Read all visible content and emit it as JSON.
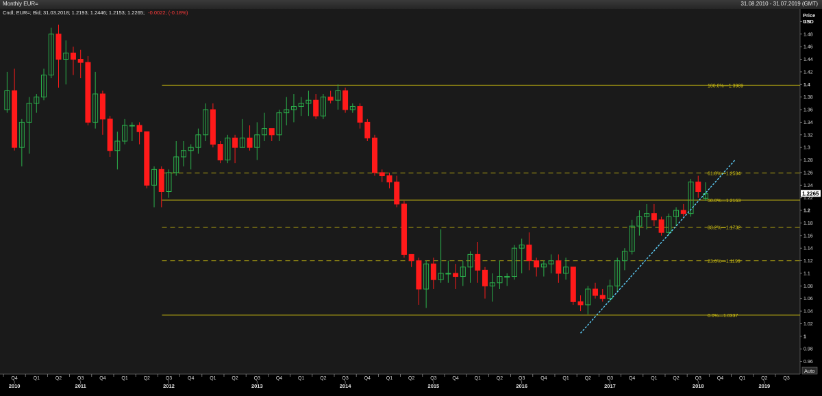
{
  "window": {
    "title": "Monthly EUR=",
    "date_range": "31.08.2010 - 31.07.2019 (GMT)"
  },
  "legend": {
    "prefix": "Cndl; EUR=; Bid; 31.03.2018; 1.2193; 1.2446; 1.2153; 1.2265;",
    "change": "-0.0022; (-0.18%)"
  },
  "axis_controls": {
    "price_label": "Price",
    "currency_label": "USD",
    "auto_button": "Auto"
  },
  "colors": {
    "background": "#1a1a1a",
    "up": "#2bb24c",
    "down": "#ff1a1a",
    "fib": "#d4c410",
    "trend": "#5fd3ff",
    "change": "#ff3b3b"
  },
  "chart_data": {
    "type": "candlestick",
    "ylim": [
      0.94,
      1.52
    ],
    "yticks": [
      "0.96",
      "0.98",
      "1",
      "1.02",
      "1.04",
      "1.06",
      "1.08",
      "1.1",
      "1.12",
      "1.14",
      "1.16",
      "1.18",
      "1.2",
      "1.22",
      "1.24",
      "1.26",
      "1.28",
      "1.3",
      "1.32",
      "1.34",
      "1.36",
      "1.38",
      "1.4",
      "1.42",
      "1.44",
      "1.46",
      "1.48",
      "1.5"
    ],
    "last_price": "1.2265",
    "start_month": "2010-10",
    "end_month": "2019-09",
    "quarters": [
      {
        "label": "Q4",
        "year": "2010"
      },
      {
        "label": "Q1",
        "year": ""
      },
      {
        "label": "Q2",
        "year": ""
      },
      {
        "label": "Q3",
        "year": "2011"
      },
      {
        "label": "Q4",
        "year": ""
      },
      {
        "label": "Q1",
        "year": ""
      },
      {
        "label": "Q2",
        "year": ""
      },
      {
        "label": "Q3",
        "year": "2012"
      },
      {
        "label": "Q4",
        "year": ""
      },
      {
        "label": "Q1",
        "year": ""
      },
      {
        "label": "Q2",
        "year": ""
      },
      {
        "label": "Q3",
        "year": "2013"
      },
      {
        "label": "Q4",
        "year": ""
      },
      {
        "label": "Q1",
        "year": ""
      },
      {
        "label": "Q2",
        "year": ""
      },
      {
        "label": "Q3",
        "year": "2014"
      },
      {
        "label": "Q4",
        "year": ""
      },
      {
        "label": "Q1",
        "year": ""
      },
      {
        "label": "Q2",
        "year": ""
      },
      {
        "label": "Q3",
        "year": "2015"
      },
      {
        "label": "Q4",
        "year": ""
      },
      {
        "label": "Q1",
        "year": ""
      },
      {
        "label": "Q2",
        "year": ""
      },
      {
        "label": "Q3",
        "year": "2016"
      },
      {
        "label": "Q4",
        "year": ""
      },
      {
        "label": "Q1",
        "year": ""
      },
      {
        "label": "Q2",
        "year": ""
      },
      {
        "label": "Q3",
        "year": "2017"
      },
      {
        "label": "Q4",
        "year": ""
      },
      {
        "label": "Q1",
        "year": ""
      },
      {
        "label": "Q2",
        "year": ""
      },
      {
        "label": "Q3",
        "year": "2018"
      },
      {
        "label": "Q4",
        "year": ""
      },
      {
        "label": "Q1",
        "year": ""
      },
      {
        "label": "Q2",
        "year": "2019"
      },
      {
        "label": "Q3",
        "year": ""
      }
    ],
    "candles": [
      {
        "date": "2010-10",
        "o": 1.36,
        "h": 1.42,
        "l": 1.355,
        "c": 1.39
      },
      {
        "date": "2010-11",
        "o": 1.39,
        "h": 1.425,
        "l": 1.295,
        "c": 1.3
      },
      {
        "date": "2010-12",
        "o": 1.3,
        "h": 1.345,
        "l": 1.27,
        "c": 1.34
      },
      {
        "date": "2011-01",
        "o": 1.34,
        "h": 1.38,
        "l": 1.29,
        "c": 1.37
      },
      {
        "date": "2011-02",
        "o": 1.37,
        "h": 1.385,
        "l": 1.355,
        "c": 1.38
      },
      {
        "date": "2011-03",
        "o": 1.38,
        "h": 1.425,
        "l": 1.375,
        "c": 1.415
      },
      {
        "date": "2011-04",
        "o": 1.415,
        "h": 1.49,
        "l": 1.41,
        "c": 1.48
      },
      {
        "date": "2011-05",
        "o": 1.48,
        "h": 1.495,
        "l": 1.395,
        "c": 1.44
      },
      {
        "date": "2011-06",
        "o": 1.44,
        "h": 1.47,
        "l": 1.4,
        "c": 1.45
      },
      {
        "date": "2011-07",
        "o": 1.45,
        "h": 1.46,
        "l": 1.415,
        "c": 1.44
      },
      {
        "date": "2011-08",
        "o": 1.44,
        "h": 1.455,
        "l": 1.41,
        "c": 1.435
      },
      {
        "date": "2011-09",
        "o": 1.435,
        "h": 1.445,
        "l": 1.335,
        "c": 1.34
      },
      {
        "date": "2011-10",
        "o": 1.34,
        "h": 1.42,
        "l": 1.33,
        "c": 1.385
      },
      {
        "date": "2011-11",
        "o": 1.385,
        "h": 1.39,
        "l": 1.32,
        "c": 1.345
      },
      {
        "date": "2011-12",
        "o": 1.345,
        "h": 1.35,
        "l": 1.285,
        "c": 1.295
      },
      {
        "date": "2012-01",
        "o": 1.295,
        "h": 1.325,
        "l": 1.265,
        "c": 1.31
      },
      {
        "date": "2012-02",
        "o": 1.31,
        "h": 1.345,
        "l": 1.305,
        "c": 1.335
      },
      {
        "date": "2012-03",
        "o": 1.335,
        "h": 1.34,
        "l": 1.31,
        "c": 1.335
      },
      {
        "date": "2012-04",
        "o": 1.335,
        "h": 1.34,
        "l": 1.305,
        "c": 1.325
      },
      {
        "date": "2012-05",
        "o": 1.325,
        "h": 1.325,
        "l": 1.235,
        "c": 1.24
      },
      {
        "date": "2012-06",
        "o": 1.24,
        "h": 1.27,
        "l": 1.205,
        "c": 1.265
      },
      {
        "date": "2012-07",
        "o": 1.265,
        "h": 1.27,
        "l": 1.205,
        "c": 1.23
      },
      {
        "date": "2012-08",
        "o": 1.23,
        "h": 1.265,
        "l": 1.22,
        "c": 1.26
      },
      {
        "date": "2012-09",
        "o": 1.26,
        "h": 1.31,
        "l": 1.255,
        "c": 1.285
      },
      {
        "date": "2012-10",
        "o": 1.285,
        "h": 1.31,
        "l": 1.27,
        "c": 1.295
      },
      {
        "date": "2012-11",
        "o": 1.295,
        "h": 1.305,
        "l": 1.265,
        "c": 1.3
      },
      {
        "date": "2012-12",
        "o": 1.3,
        "h": 1.33,
        "l": 1.29,
        "c": 1.32
      },
      {
        "date": "2013-01",
        "o": 1.32,
        "h": 1.37,
        "l": 1.31,
        "c": 1.36
      },
      {
        "date": "2013-02",
        "o": 1.36,
        "h": 1.37,
        "l": 1.3,
        "c": 1.305
      },
      {
        "date": "2013-03",
        "o": 1.305,
        "h": 1.31,
        "l": 1.275,
        "c": 1.28
      },
      {
        "date": "2013-04",
        "o": 1.28,
        "h": 1.32,
        "l": 1.275,
        "c": 1.315
      },
      {
        "date": "2013-05",
        "o": 1.315,
        "h": 1.32,
        "l": 1.275,
        "c": 1.3
      },
      {
        "date": "2013-06",
        "o": 1.3,
        "h": 1.345,
        "l": 1.3,
        "c": 1.315
      },
      {
        "date": "2013-07",
        "o": 1.315,
        "h": 1.335,
        "l": 1.295,
        "c": 1.3
      },
      {
        "date": "2013-08",
        "o": 1.3,
        "h": 1.34,
        "l": 1.28,
        "c": 1.32
      },
      {
        "date": "2013-09",
        "o": 1.32,
        "h": 1.355,
        "l": 1.31,
        "c": 1.33
      },
      {
        "date": "2013-10",
        "o": 1.33,
        "h": 1.33,
        "l": 1.31,
        "c": 1.32
      },
      {
        "date": "2013-11",
        "o": 1.32,
        "h": 1.36,
        "l": 1.31,
        "c": 1.355
      },
      {
        "date": "2013-12",
        "o": 1.355,
        "h": 1.38,
        "l": 1.335,
        "c": 1.36
      },
      {
        "date": "2014-01",
        "o": 1.36,
        "h": 1.385,
        "l": 1.34,
        "c": 1.365
      },
      {
        "date": "2014-02",
        "o": 1.365,
        "h": 1.38,
        "l": 1.35,
        "c": 1.37
      },
      {
        "date": "2014-03",
        "o": 1.37,
        "h": 1.39,
        "l": 1.35,
        "c": 1.375
      },
      {
        "date": "2014-04",
        "o": 1.375,
        "h": 1.385,
        "l": 1.345,
        "c": 1.35
      },
      {
        "date": "2014-05",
        "o": 1.35,
        "h": 1.385,
        "l": 1.345,
        "c": 1.38
      },
      {
        "date": "2014-06",
        "o": 1.38,
        "h": 1.39,
        "l": 1.37,
        "c": 1.375
      },
      {
        "date": "2014-07",
        "o": 1.375,
        "h": 1.4,
        "l": 1.36,
        "c": 1.39
      },
      {
        "date": "2014-08",
        "o": 1.39,
        "h": 1.395,
        "l": 1.355,
        "c": 1.36
      },
      {
        "date": "2014-09",
        "o": 1.36,
        "h": 1.37,
        "l": 1.355,
        "c": 1.365
      },
      {
        "date": "2014-10",
        "o": 1.365,
        "h": 1.37,
        "l": 1.33,
        "c": 1.34
      },
      {
        "date": "2014-11",
        "o": 1.34,
        "h": 1.345,
        "l": 1.31,
        "c": 1.315
      },
      {
        "date": "2014-12",
        "o": 1.315,
        "h": 1.32,
        "l": 1.255,
        "c": 1.26
      },
      {
        "date": "2015-01",
        "o": 1.26,
        "h": 1.265,
        "l": 1.245,
        "c": 1.255
      },
      {
        "date": "2015-02",
        "o": 1.255,
        "h": 1.26,
        "l": 1.235,
        "c": 1.245
      },
      {
        "date": "2015-03",
        "o": 1.245,
        "h": 1.255,
        "l": 1.205,
        "c": 1.21
      },
      {
        "date": "2015-04",
        "o": 1.21,
        "h": 1.215,
        "l": 1.125,
        "c": 1.13
      },
      {
        "date": "2015-05",
        "o": 1.13,
        "h": 1.13,
        "l": 1.11,
        "c": 1.12
      },
      {
        "date": "2015-06",
        "o": 1.12,
        "h": 1.125,
        "l": 1.05,
        "c": 1.075
      },
      {
        "date": "2015-07",
        "o": 1.075,
        "h": 1.12,
        "l": 1.045,
        "c": 1.115
      },
      {
        "date": "2015-08",
        "o": 1.115,
        "h": 1.125,
        "l": 1.075,
        "c": 1.09
      },
      {
        "date": "2015-09",
        "o": 1.09,
        "h": 1.17,
        "l": 1.085,
        "c": 1.1
      },
      {
        "date": "2015-10",
        "o": 1.1,
        "h": 1.12,
        "l": 1.085,
        "c": 1.1
      },
      {
        "date": "2015-11",
        "o": 1.1,
        "h": 1.115,
        "l": 1.075,
        "c": 1.095
      },
      {
        "date": "2015-12",
        "o": 1.095,
        "h": 1.12,
        "l": 1.08,
        "c": 1.11
      },
      {
        "date": "2016-01",
        "o": 1.11,
        "h": 1.135,
        "l": 1.085,
        "c": 1.13
      },
      {
        "date": "2016-02",
        "o": 1.13,
        "h": 1.15,
        "l": 1.085,
        "c": 1.105
      },
      {
        "date": "2016-03",
        "o": 1.105,
        "h": 1.11,
        "l": 1.06,
        "c": 1.08
      },
      {
        "date": "2016-04",
        "o": 1.08,
        "h": 1.1,
        "l": 1.055,
        "c": 1.085
      },
      {
        "date": "2016-05",
        "o": 1.085,
        "h": 1.12,
        "l": 1.075,
        "c": 1.095
      },
      {
        "date": "2016-06",
        "o": 1.095,
        "h": 1.1,
        "l": 1.08,
        "c": 1.095
      },
      {
        "date": "2016-07",
        "o": 1.095,
        "h": 1.145,
        "l": 1.09,
        "c": 1.14
      },
      {
        "date": "2016-08",
        "o": 1.14,
        "h": 1.155,
        "l": 1.1,
        "c": 1.145
      },
      {
        "date": "2016-09",
        "o": 1.145,
        "h": 1.165,
        "l": 1.105,
        "c": 1.12
      },
      {
        "date": "2016-10",
        "o": 1.12,
        "h": 1.125,
        "l": 1.095,
        "c": 1.11
      },
      {
        "date": "2016-11",
        "o": 1.11,
        "h": 1.12,
        "l": 1.095,
        "c": 1.115
      },
      {
        "date": "2016-12",
        "o": 1.115,
        "h": 1.13,
        "l": 1.1,
        "c": 1.12
      },
      {
        "date": "2017-01",
        "o": 1.12,
        "h": 1.13,
        "l": 1.085,
        "c": 1.1
      },
      {
        "date": "2017-02",
        "o": 1.1,
        "h": 1.125,
        "l": 1.09,
        "c": 1.11
      },
      {
        "date": "2017-03",
        "o": 1.11,
        "h": 1.11,
        "l": 1.05,
        "c": 1.055
      },
      {
        "date": "2017-04",
        "o": 1.055,
        "h": 1.065,
        "l": 1.04,
        "c": 1.05
      },
      {
        "date": "2017-05",
        "o": 1.05,
        "h": 1.08,
        "l": 1.035,
        "c": 1.075
      },
      {
        "date": "2017-06",
        "o": 1.075,
        "h": 1.085,
        "l": 1.06,
        "c": 1.065
      },
      {
        "date": "2017-07",
        "o": 1.065,
        "h": 1.075,
        "l": 1.055,
        "c": 1.06
      },
      {
        "date": "2017-08",
        "o": 1.06,
        "h": 1.09,
        "l": 1.055,
        "c": 1.08
      },
      {
        "date": "2017-09",
        "o": 1.08,
        "h": 1.125,
        "l": 1.07,
        "c": 1.12
      },
      {
        "date": "2017-10",
        "o": 1.12,
        "h": 1.14,
        "l": 1.105,
        "c": 1.135
      },
      {
        "date": "2017-11",
        "o": 1.135,
        "h": 1.185,
        "l": 1.13,
        "c": 1.175
      },
      {
        "date": "2017-12",
        "o": 1.175,
        "h": 1.2,
        "l": 1.16,
        "c": 1.19
      },
      {
        "date": "2018-01",
        "o": 1.19,
        "h": 1.21,
        "l": 1.17,
        "c": 1.195
      },
      {
        "date": "2018-02",
        "o": 1.195,
        "h": 1.21,
        "l": 1.175,
        "c": 1.185
      },
      {
        "date": "2018-03",
        "o": 1.185,
        "h": 1.19,
        "l": 1.16,
        "c": 1.165
      },
      {
        "date": "2018-04",
        "o": 1.165,
        "h": 1.195,
        "l": 1.16,
        "c": 1.19
      },
      {
        "date": "2018-05",
        "o": 1.19,
        "h": 1.205,
        "l": 1.175,
        "c": 1.2
      },
      {
        "date": "2018-06",
        "o": 1.2,
        "h": 1.21,
        "l": 1.19,
        "c": 1.195
      },
      {
        "date": "2018-07",
        "o": 1.195,
        "h": 1.25,
        "l": 1.19,
        "c": 1.245
      },
      {
        "date": "2018-08",
        "o": 1.245,
        "h": 1.255,
        "l": 1.22,
        "c": 1.23
      },
      {
        "date": "2018-09",
        "o": 1.2193,
        "h": 1.2446,
        "l": 1.2153,
        "c": 1.2265
      }
    ],
    "fib_levels": [
      {
        "label": "100.0%",
        "value": 1.3989,
        "text": "1.3989",
        "style": "solid"
      },
      {
        "label": "61.8%",
        "value": 1.2594,
        "text": "1.2594",
        "style": "dashed"
      },
      {
        "label": "50.0%",
        "value": 1.2163,
        "text": "1.2163",
        "style": "solid"
      },
      {
        "label": "38.2%",
        "value": 1.1732,
        "text": "1.1732",
        "style": "dashed"
      },
      {
        "label": "23.6%",
        "value": 1.1199,
        "text": "1.1199",
        "style": "dashed"
      },
      {
        "label": "0.0%",
        "value": 1.0337,
        "text": "1.0337",
        "style": "solid"
      }
    ],
    "fib_start": "2012-08",
    "trendline": {
      "start": {
        "date": "2017-04",
        "value": 1.005
      },
      "end": {
        "date": "2019-01",
        "value": 1.28
      }
    }
  }
}
